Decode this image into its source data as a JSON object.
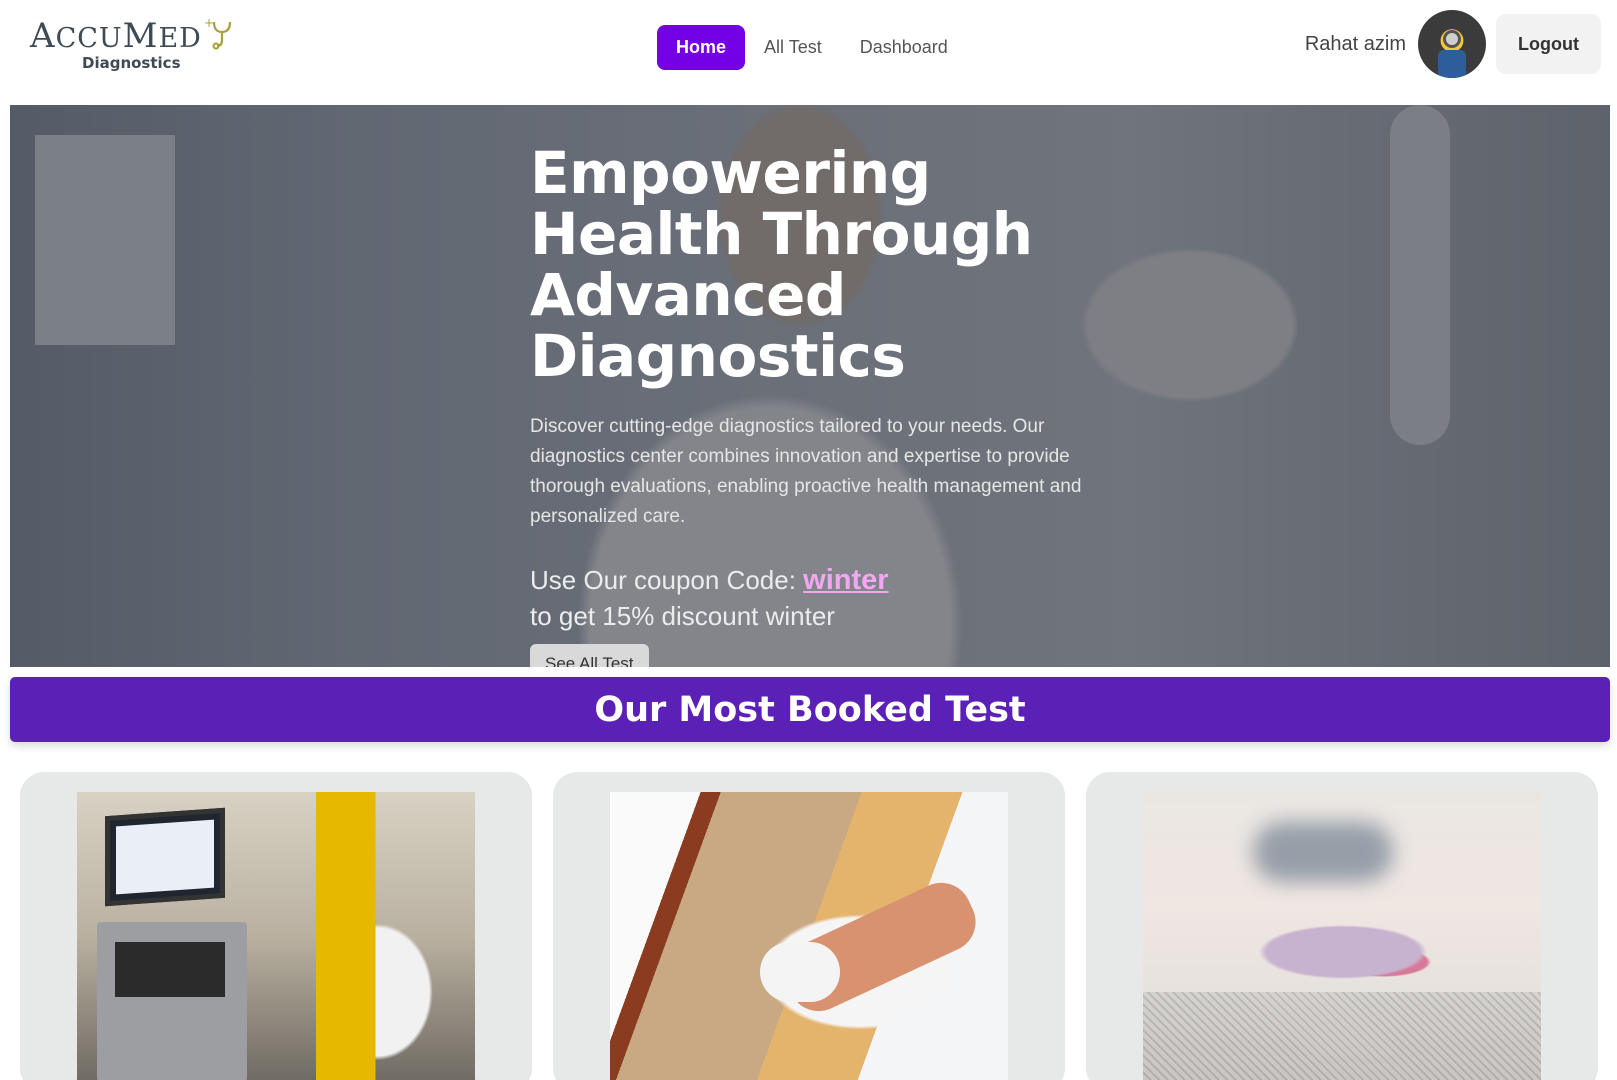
{
  "brand": {
    "name_first": "A",
    "name_rest": "CCU",
    "name_second": "M",
    "name_second_rest": "ED",
    "sub": "Diagnostics",
    "accent_color": "#a8a03c"
  },
  "nav": {
    "items": [
      {
        "label": "Home",
        "active": true
      },
      {
        "label": "All Test",
        "active": false
      },
      {
        "label": "Dashboard",
        "active": false
      }
    ],
    "active_color": "#7400e4"
  },
  "user": {
    "name": "Rahat azim",
    "logout_label": "Logout"
  },
  "hero": {
    "title": "Empowering Health Through Advanced Diagnostics",
    "description": "Discover cutting-edge diagnostics tailored to your needs. Our diagnostics center combines innovation and expertise to provide thorough evaluations, enabling proactive health management and personalized care.",
    "coupon_prefix": "Use Our coupon Code: ",
    "coupon_code": "winter",
    "coupon_suffix": "to get 15% discount winter",
    "cta_label": "See All Test"
  },
  "section": {
    "title": "Our Most Booked Test",
    "color": "#5b20b6"
  },
  "cards": [
    {
      "image": "lab-microscope-image"
    },
    {
      "image": "blood-draw-image"
    },
    {
      "image": "petri-dish-image"
    }
  ]
}
